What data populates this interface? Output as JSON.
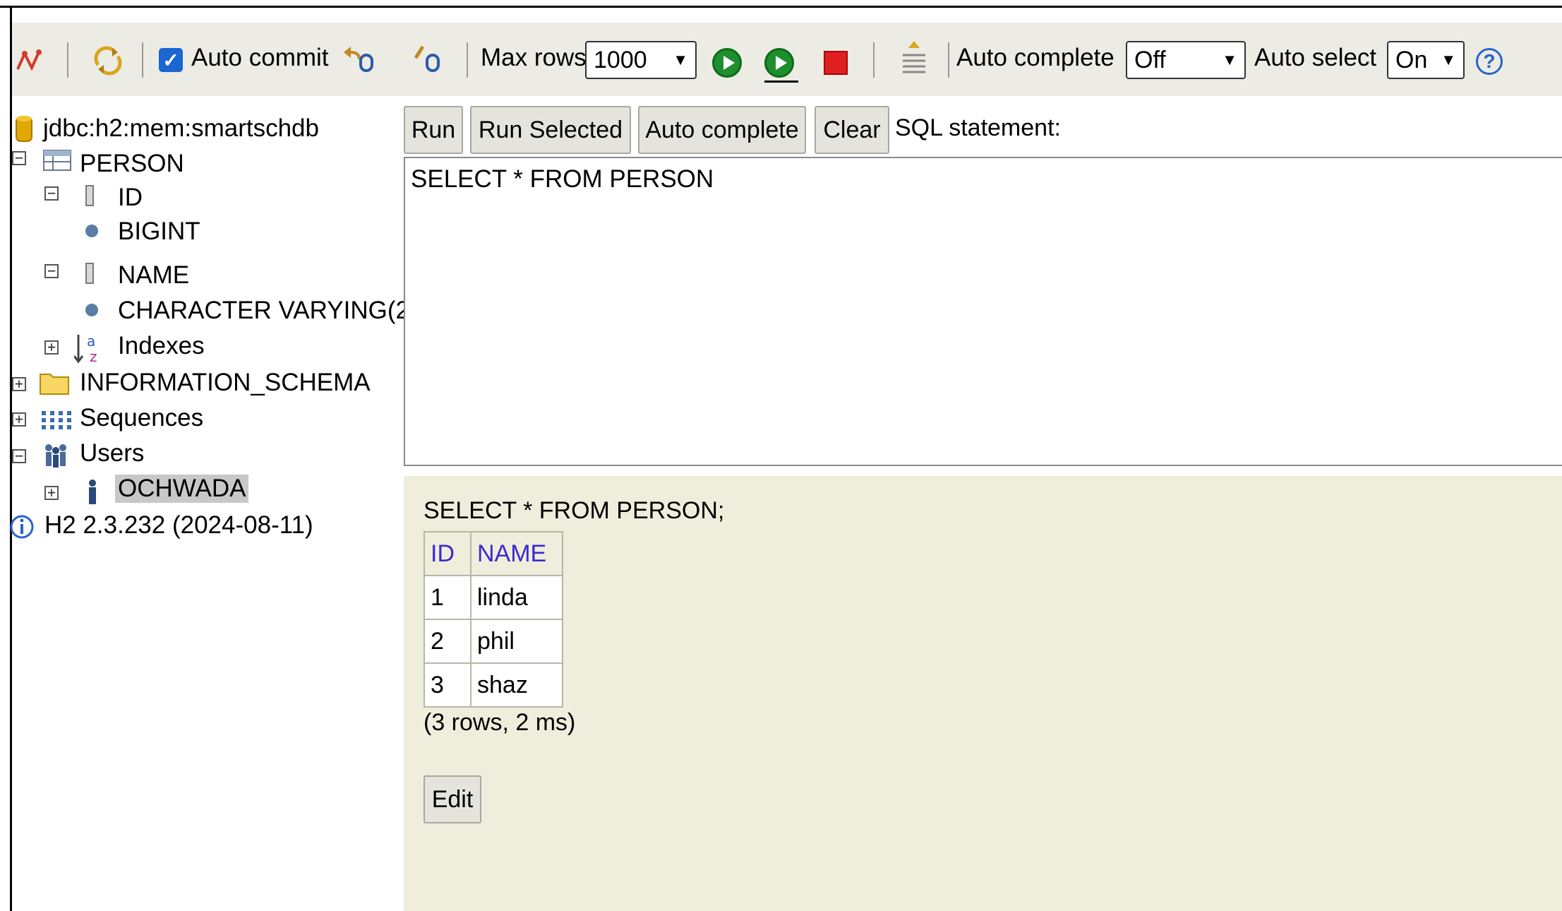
{
  "toolbar": {
    "auto_commit_label": "Auto commit",
    "auto_commit_checked": true,
    "max_rows_label": "Max rows:",
    "max_rows_value": "1000",
    "auto_complete_label": "Auto complete",
    "auto_complete_value": "Off",
    "auto_select_label": "Auto select",
    "auto_select_value": "On",
    "help_glyph": "?"
  },
  "tree": {
    "connection": "jdbc:h2:mem:smartschdb",
    "table": "PERSON",
    "columns": [
      {
        "name": "ID",
        "type": "BIGINT"
      },
      {
        "name": "NAME",
        "type": "CHARACTER VARYING(2"
      }
    ],
    "indexes": "Indexes",
    "schema": "INFORMATION_SCHEMA",
    "sequences": "Sequences",
    "users": "Users",
    "user": "OCHWADA",
    "version": "H2 2.3.232 (2024-08-11)"
  },
  "command": {
    "run": "Run",
    "run_selected": "Run Selected",
    "auto_complete": "Auto complete",
    "clear": "Clear",
    "sql_label": "SQL statement:",
    "sql_text": "SELECT * FROM PERSON"
  },
  "result": {
    "query": "SELECT * FROM PERSON;",
    "headers": [
      "ID",
      "NAME"
    ],
    "rows": [
      [
        "1",
        "linda"
      ],
      [
        "2",
        "phil"
      ],
      [
        "3",
        "shaz"
      ]
    ],
    "info": "(3 rows, 2 ms)",
    "edit": "Edit"
  },
  "colors": {
    "toolbar_bg": "#ecece4",
    "result_bg": "#efeedd",
    "header_text": "#3b2ad0",
    "run_green": "#1e8f2d",
    "stop_red": "#e02020",
    "checkbox_blue": "#1a66d2"
  }
}
